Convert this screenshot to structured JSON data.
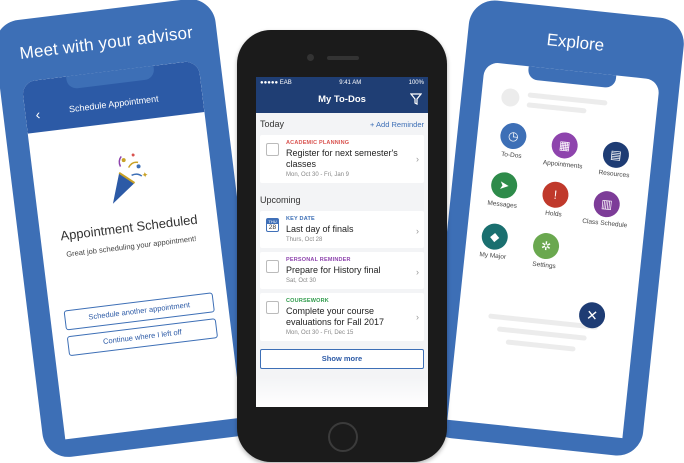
{
  "left_card": {
    "title": "Meet with your advisor",
    "header_title": "Schedule Appointment",
    "heading": "Appointment Scheduled",
    "subtext": "Great job scheduling your appointment!",
    "buttons": [
      "Schedule another appointment",
      "Continue where I left off"
    ]
  },
  "phone": {
    "status": {
      "carrier": "●●●●● EAB",
      "time": "9:41 AM",
      "battery": "100%"
    },
    "nav_title": "My To-Dos",
    "today_label": "Today",
    "add_reminder": "+ Add Reminder",
    "upcoming_label": "Upcoming",
    "items": [
      {
        "category": "ACADEMIC PLANNING",
        "color": "#d9534f",
        "title": "Register for next semester's classes",
        "date": "Mon, Oct 30 - Fri, Jan 9"
      },
      {
        "category": "KEY DATE",
        "color": "#3d6fb6",
        "title": "Last day of finals",
        "date": "Thurs, Oct 28",
        "cal_month": "THU",
        "cal_day": "28"
      },
      {
        "category": "PERSONAL REMINDER",
        "color": "#8e44ad",
        "title": "Prepare for History final",
        "date": "Sat, Oct 30"
      },
      {
        "category": "COURSEWORK",
        "color": "#2e9a4a",
        "title": "Complete your course evaluations for Fall 2017",
        "date": "Mon, Oct 30 - Fri, Dec 15"
      }
    ],
    "show_more": "Show more"
  },
  "right_card": {
    "title": "Explore",
    "tiles": [
      {
        "label": "To-Dos",
        "icon": "todo-icon",
        "color": "#3d6fb6",
        "glyph": "◷"
      },
      {
        "label": "Appointments",
        "icon": "calendar-icon",
        "color": "#8e44ad",
        "glyph": "▦"
      },
      {
        "label": "Resources",
        "icon": "book-icon",
        "color": "#1e3c74",
        "glyph": "▤"
      },
      {
        "label": "Messages",
        "icon": "send-icon",
        "color": "#2e8b4a",
        "glyph": "➤"
      },
      {
        "label": "Holds",
        "icon": "warning-icon",
        "color": "#c0392b",
        "glyph": "!"
      },
      {
        "label": "Class Schedule",
        "icon": "schedule-icon",
        "color": "#7d3c98",
        "glyph": "▥"
      },
      {
        "label": "My Major",
        "icon": "graduation-cap-icon",
        "color": "#1a6f6f",
        "glyph": "◆"
      },
      {
        "label": "Settings",
        "icon": "gear-icon",
        "color": "#6aa84f",
        "glyph": "✲"
      }
    ],
    "close_glyph": "✕"
  }
}
